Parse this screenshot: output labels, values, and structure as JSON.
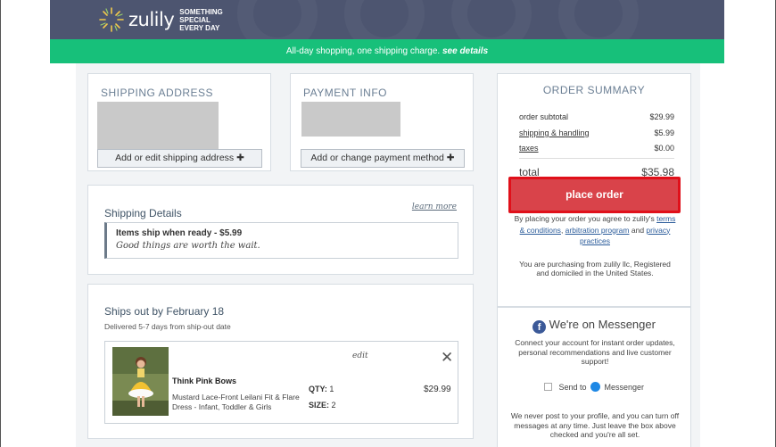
{
  "header": {
    "logo_text": "zulily",
    "tagline": [
      "SOMETHING",
      "SPECIAL",
      "EVERY DAY"
    ]
  },
  "banner": {
    "text": "All-day shopping, one shipping charge.",
    "link": "see details"
  },
  "shipping_address": {
    "title": "SHIPPING ADDRESS",
    "button": "Add or edit shipping address"
  },
  "payment_info": {
    "title": "PAYMENT INFO",
    "button": "Add or change payment method"
  },
  "shipping_details": {
    "title": "Shipping Details",
    "learn_more": "learn more",
    "option_title": "Items ship when ready - $5.99",
    "option_sub": "Good things are worth the wait."
  },
  "ships_out": {
    "title": "Ships out by February 18",
    "subtitle": "Delivered 5-7 days from ship-out date",
    "item": {
      "edit": "edit",
      "brand": "Think Pink Bows",
      "name": "Mustard Lace-Front Leilani Fit & Flare Dress - Infant, Toddler & Girls",
      "qty_label": "QTY:",
      "qty": "1",
      "size_label": "SIZE:",
      "size": "2",
      "price": "$29.99"
    }
  },
  "order_summary": {
    "title": "ORDER SUMMARY",
    "rows": [
      {
        "label": "order subtotal",
        "value": "$29.99"
      },
      {
        "label": "shipping & handling",
        "value": "$5.99"
      },
      {
        "label": "taxes",
        "value": "$0.00"
      }
    ],
    "total_label": "total",
    "total_value": "$35.98",
    "place_order": "place order",
    "agree_prefix": "By placing your order you agree to zulily's",
    "terms": "terms & conditions",
    "arbitration": "arbitration program",
    "and": "and",
    "privacy": "privacy practices",
    "seller_note": "You are purchasing from zulily llc, Registered and domiciled in the United States."
  },
  "messenger": {
    "title": "We're on Messenger",
    "desc": "Connect your account for instant order updates, personal recommendations and live customer support!",
    "send_to": "Send to",
    "messenger_label": "Messenger",
    "note": "We never post to your profile, and you can turn off messages at any time. Just leave the box above checked and you're all set."
  },
  "colors": {
    "header_bg": "#4d5570",
    "banner_bg": "#17c07a",
    "place_order_bg": "#d9434a",
    "highlight": "#e0101a"
  }
}
